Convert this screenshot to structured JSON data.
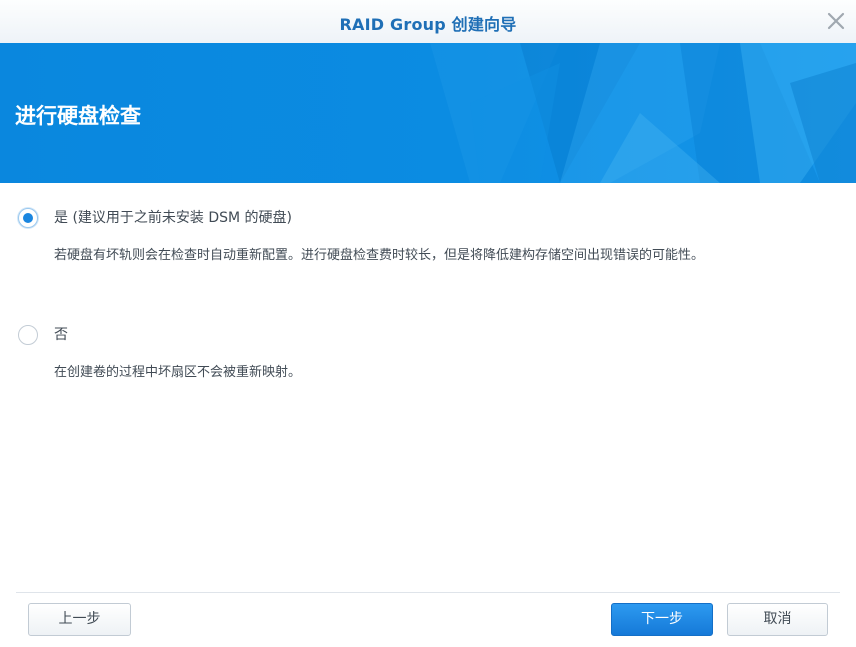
{
  "window": {
    "title": "RAID Group 创建向导",
    "close_icon": "close-icon"
  },
  "banner": {
    "heading": "进行硬盘检查",
    "color": "#0a8be0"
  },
  "options": [
    {
      "label": "是 (建议用于之前未安装 DSM 的硬盘)",
      "description": "若硬盘有坏轨则会在检查时自动重新配置。进行硬盘检查费时较长，但是将降低建构存储空间出现错误的可能性。",
      "selected": true
    },
    {
      "label": "否",
      "description": "在创建卷的过程中坏扇区不会被重新映射。",
      "selected": false
    }
  ],
  "footer": {
    "prev_label": "上一步",
    "next_label": "下一步",
    "cancel_label": "取消"
  },
  "colors": {
    "accent": "#1a86e0",
    "title_text": "#1f6fb6"
  }
}
